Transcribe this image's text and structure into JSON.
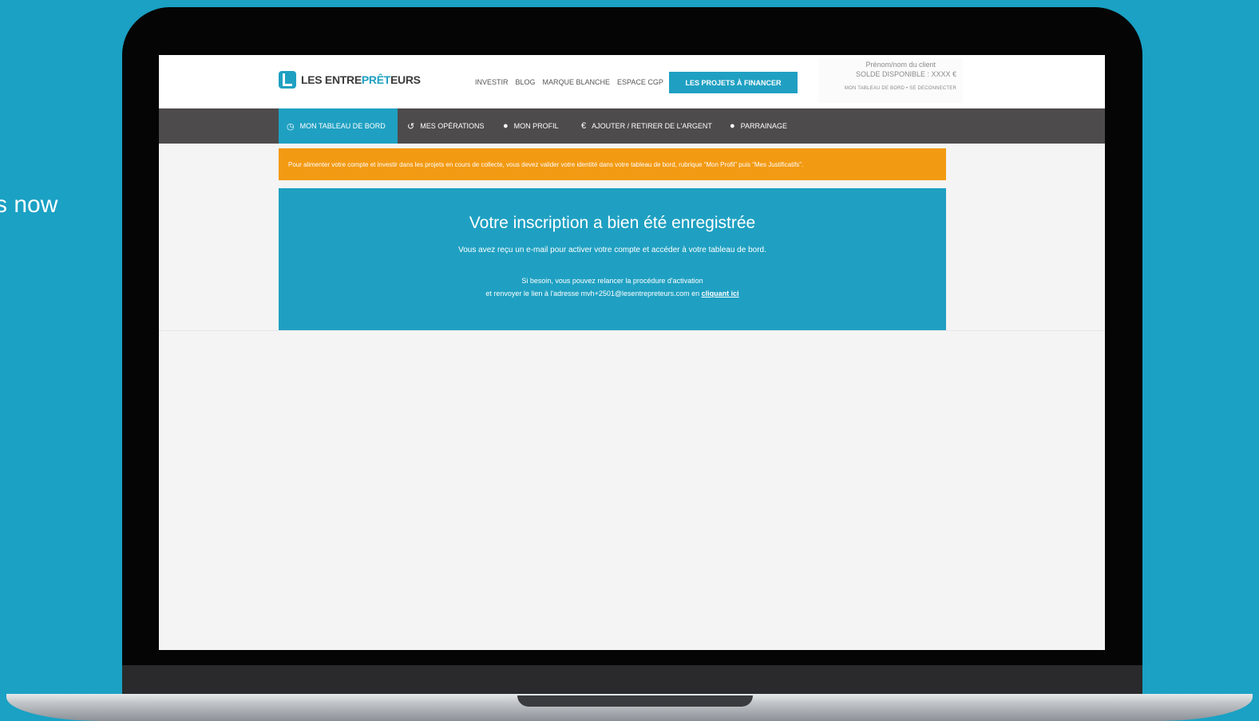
{
  "slide_text": "s now",
  "colors": {
    "background": "#1aa1c4",
    "brand": "#1fa0c2",
    "nav_bg": "#4e4b4d",
    "alert": "#f39a13"
  },
  "header": {
    "logo_text_a": "LES ENTRE",
    "logo_text_b": "PRÊT",
    "logo_text_c": "EURS",
    "nav": [
      "INVESTIR",
      "BLOG",
      "MARQUE BLANCHE",
      "ESPACE CGP"
    ],
    "cta_label": "LES PROJETS À FINANCER",
    "user_name": "Prénom/nom du client",
    "user_balance": "SOLDE DISPONIBLE : XXXX €",
    "user_links": "MON TABLEAU DE BORD • SE DECONNECTER"
  },
  "subnav": [
    {
      "label": "MON TABLEAU DE BORD",
      "icon": "dashboard-icon",
      "glyph": "◷"
    },
    {
      "label": "MES OPÉRATIONS",
      "icon": "history-icon",
      "glyph": "↺"
    },
    {
      "label": "MON PROFIL",
      "icon": "user-icon",
      "glyph": "●"
    },
    {
      "label": "AJOUTER / RETIRER DE L'ARGENT",
      "icon": "euro-icon",
      "glyph": "€"
    },
    {
      "label": "PARRAINAGE",
      "icon": "user-icon",
      "glyph": "●"
    }
  ],
  "alert": "Pour alimenter votre compte et investir dans les projets en cours de collecte, vous devez valider votre identité dans votre tableau de bord, rubrique “Mon Profil” puis “Mes Justificatifs”.",
  "panel": {
    "title": "Votre inscription a bien été enregistrée",
    "message": "Vous avez reçu un e-mail pour activer votre compte et accéder à votre tableau de bord.",
    "help_line1": "Si besoin, vous pouvez relancer la procédure d'activation",
    "help_line2": "et renvoyer le lien à l'adresse mvh+2501@lesentrepreteurs.com en ",
    "link_label": "cliquant ici"
  }
}
